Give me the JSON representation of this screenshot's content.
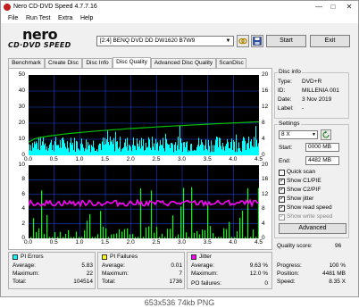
{
  "window": {
    "title": "Nero CD-DVD Speed 4.7.7.16",
    "min": "—",
    "max": "□",
    "close": "✕"
  },
  "menu": [
    "File",
    "Run Test",
    "Extra",
    "Help"
  ],
  "brand": {
    "name": "nero",
    "product": "CD·DVD SPEED"
  },
  "toolbar": {
    "drive": "[2:4]   BENQ DVD DD DW1620 B7W9",
    "start": "Start",
    "exit": "Exit"
  },
  "tabs": [
    "Benchmark",
    "Create Disc",
    "Disc Info",
    "Disc Quality",
    "Advanced Disc Quality",
    "ScanDisc"
  ],
  "active_tab": "Disc Quality",
  "chart_top": {
    "y_left_ticks": [
      "50",
      "40",
      "30",
      "20",
      "10",
      "0"
    ],
    "y_right_ticks": [
      "20",
      "16",
      "12",
      "8",
      "4",
      "0"
    ],
    "x_ticks": [
      "0.0",
      "0.5",
      "1.0",
      "1.5",
      "2.0",
      "2.5",
      "3.0",
      "3.5",
      "4.0",
      "4.5"
    ]
  },
  "chart_bottom": {
    "y_left_ticks": [
      "10",
      "8",
      "6",
      "4",
      "2",
      "0"
    ],
    "y_right_ticks": [
      "20",
      "16",
      "12",
      "8",
      "4",
      "0"
    ],
    "x_ticks": [
      "0.0",
      "0.5",
      "1.0",
      "1.5",
      "2.0",
      "2.5",
      "3.0",
      "3.5",
      "4.0",
      "4.5"
    ]
  },
  "chart_data": [
    {
      "type": "bar",
      "description_series": [
        {
          "name": "PI Errors",
          "color": "#00ffff"
        },
        {
          "name": "Read speed",
          "color": "#00c000"
        }
      ],
      "xlim": [
        0,
        4.5
      ],
      "ylim_left": [
        0,
        50
      ],
      "ylim_right": [
        0,
        20
      ],
      "pi_errors_typical_range": [
        2,
        12
      ],
      "read_speed_start": 3.3,
      "read_speed_end": 8.35
    },
    {
      "type": "bar",
      "description_series": [
        {
          "name": "PI Failures",
          "color": "#00ff00"
        },
        {
          "name": "Jitter",
          "color": "#ff00ff"
        }
      ],
      "xlim": [
        0,
        4.5
      ],
      "ylim_left": [
        0,
        10
      ],
      "ylim_right": [
        0,
        20
      ],
      "jitter_level": 9.63
    }
  ],
  "disc_info": {
    "title": "Disc info",
    "type_label": "Type:",
    "type_value": "DVD+R",
    "id_label": "ID:",
    "id_value": "MILLENIA 001",
    "date_label": "Date:",
    "date_value": "3 Nov 2019",
    "label_label": "Label:",
    "label_value": "-"
  },
  "settings": {
    "title": "Settings",
    "speed": "8 X",
    "start_label": "Start:",
    "start_value": "0000 MB",
    "end_label": "End:",
    "end_value": "4482 MB",
    "checks": [
      {
        "label": "Quick scan",
        "checked": false,
        "disabled": false
      },
      {
        "label": "Show C1/PIE",
        "checked": true,
        "disabled": false
      },
      {
        "label": "Show C2/PIF",
        "checked": true,
        "disabled": false
      },
      {
        "label": "Show jitter",
        "checked": true,
        "disabled": false
      },
      {
        "label": "Show read speed",
        "checked": true,
        "disabled": false
      },
      {
        "label": "Show write speed",
        "checked": true,
        "disabled": true
      }
    ],
    "advanced": "Advanced"
  },
  "quality": {
    "label": "Quality score:",
    "value": "96"
  },
  "progress": {
    "progress_label": "Progress:",
    "progress_value": "100 %",
    "position_label": "Position:",
    "position_value": "4481 MB",
    "speed_label": "Speed:",
    "speed_value": "8.35 X"
  },
  "stats": {
    "pi_errors": {
      "title": "PI Errors",
      "color": "#00ffff",
      "avg_label": "Average:",
      "avg": "5.83",
      "max_label": "Maximum:",
      "max": "22",
      "total_label": "Total:",
      "total": "104514"
    },
    "pi_failures": {
      "title": "PI Failures",
      "color": "#ffff00",
      "avg_label": "Average:",
      "avg": "0.01",
      "max_label": "Maximum:",
      "max": "7",
      "total_label": "Total:",
      "total": "1736"
    },
    "jitter": {
      "title": "Jitter",
      "color": "#ff00ff",
      "avg_label": "Average:",
      "avg": "9.63 %",
      "max_label": "Maximum:",
      "max": "12.0 %",
      "po_label": "PO failures:",
      "po": "0"
    }
  },
  "caption": "653x536  74kb  PNG"
}
